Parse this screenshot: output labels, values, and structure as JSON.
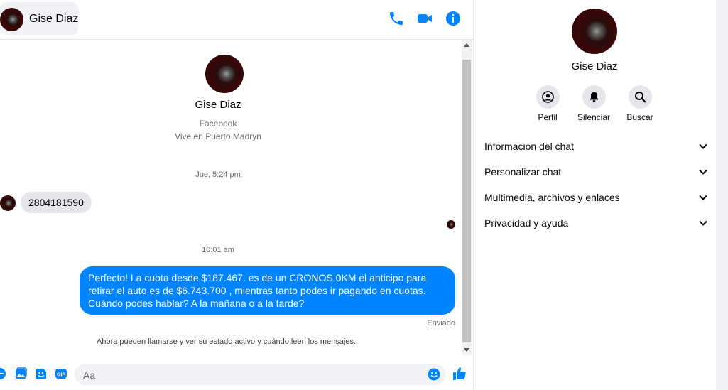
{
  "header": {
    "contact_name": "Gise Diaz"
  },
  "profile": {
    "name": "Gise Diaz",
    "source": "Facebook",
    "location": "Vive en Puerto Madryn"
  },
  "messages": {
    "timestamp_1": "Jue, 5:24 pm",
    "incoming_1": "2804181590",
    "timestamp_2": "10:01 am",
    "outgoing_1": "Perfecto! La cuota desde $187.467. es de un CRONOS 0KM el anticipo para retirar el auto es de $6.743.700 , mientras tanto podes ir pagando en cuotas. Cuándo podes hablar? A la mañana o a la tarde?",
    "status": "Enviado",
    "notice": "Ahora pueden llamarse y ver su estado activo y cuándo leen los mensajes."
  },
  "composer": {
    "placeholder": "Aa"
  },
  "sidebar": {
    "name": "Gise Diaz",
    "actions": [
      {
        "label": "Perfil",
        "icon": "profile-icon"
      },
      {
        "label": "Silenciar",
        "icon": "bell-icon"
      },
      {
        "label": "Buscar",
        "icon": "search-icon"
      }
    ],
    "menu": [
      {
        "label": "Información del chat"
      },
      {
        "label": "Personalizar chat"
      },
      {
        "label": "Multimedia, archivos y enlaces"
      },
      {
        "label": "Privacidad y ayuda"
      }
    ]
  },
  "colors": {
    "accent": "#0084ff",
    "bubble_incoming": "#e4e6eb",
    "panel_bg": "#f0f2f5"
  }
}
